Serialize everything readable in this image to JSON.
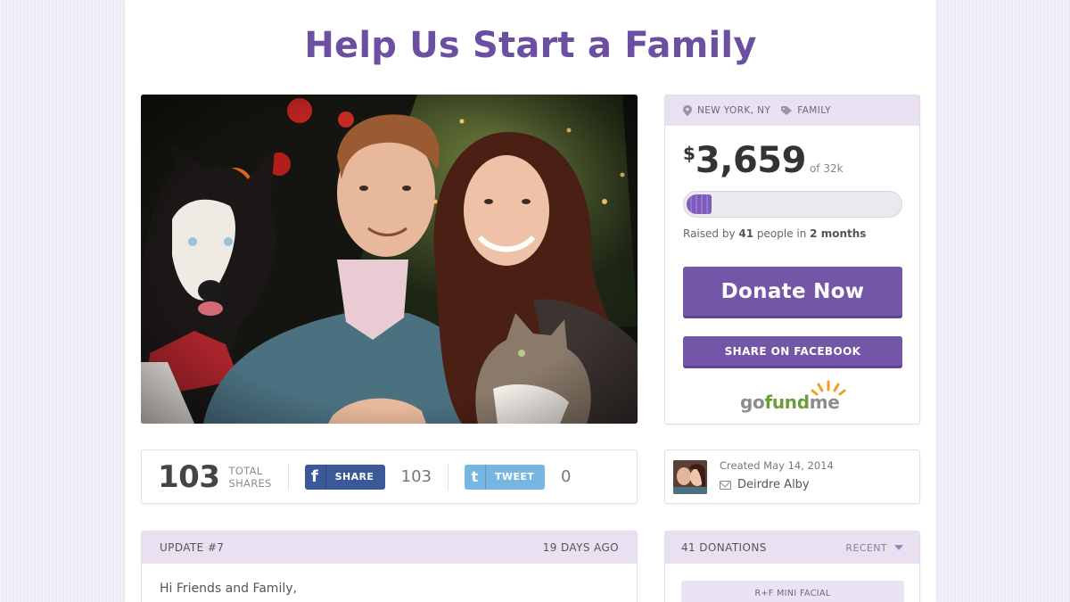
{
  "campaign": {
    "title": "Help Us Start a Family",
    "location": "NEW YORK, NY",
    "category": "FAMILY",
    "currency": "$",
    "raised_amount": "3,659",
    "goal_text": "of 32k",
    "progress_fraction": 0.114,
    "raised_prefix": "Raised by",
    "donor_count": "41",
    "raised_middle": "people in",
    "duration": "2 months",
    "donate_label": "Donate Now",
    "facebook_label": "SHARE ON FACEBOOK",
    "logo": {
      "go": "go",
      "fund": "fund",
      "me": "me"
    }
  },
  "shares": {
    "total": "103",
    "total_label_1": "TOTAL",
    "total_label_2": "SHARES",
    "facebook_button": "SHARE",
    "facebook_count": "103",
    "twitter_button": "TWEET",
    "twitter_count": "0"
  },
  "creator": {
    "created": "Created May 14, 2014",
    "name": "Deirdre Alby"
  },
  "update": {
    "label": "UPDATE #7",
    "age": "19 DAYS AGO",
    "body_start": "Hi Friends and Family,"
  },
  "donations": {
    "count_label": "41 DONATIONS",
    "sort_label": "RECENT",
    "first_item": "R+F MINI FACIAL"
  },
  "colors": {
    "brand_purple": "#7356a8",
    "title_purple": "#6b4fa0",
    "header_lavender": "#e9e1f2",
    "facebook_blue": "#3b5998",
    "twitter_blue": "#77b6e0"
  }
}
